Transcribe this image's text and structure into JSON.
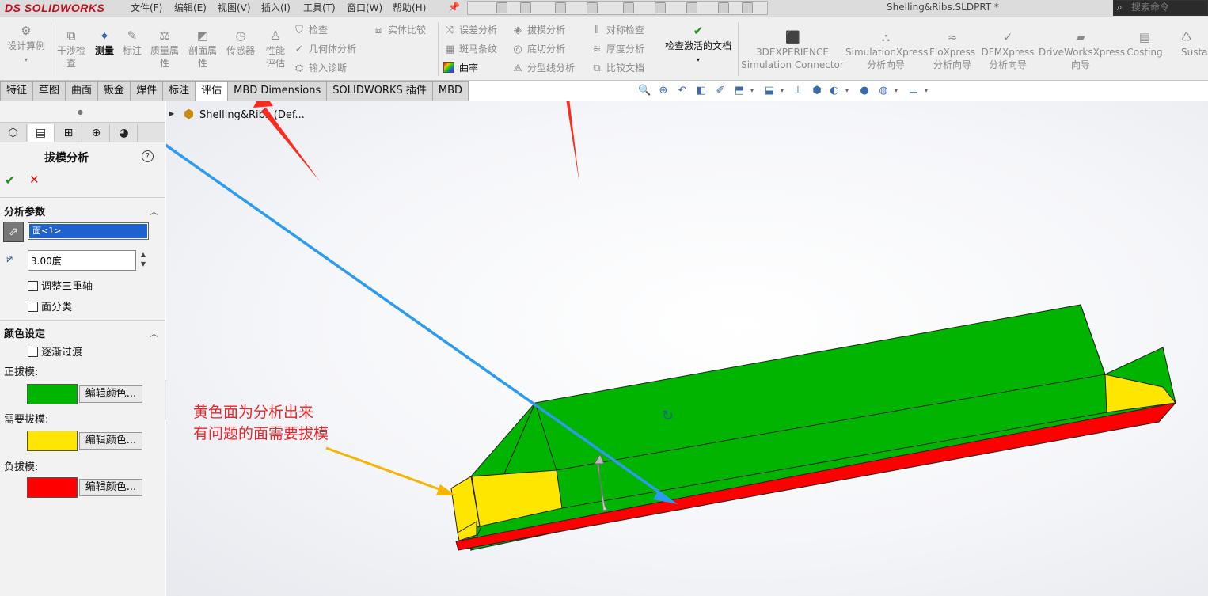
{
  "app": {
    "logo_prefix": "DS",
    "logo_text": "SOLIDWORKS",
    "document_title": "Shelling&Ribs.SLDPRT *",
    "search_placeholder": "搜索命令",
    "menu": [
      "文件(F)",
      "编辑(E)",
      "视图(V)",
      "插入(I)",
      "工具(T)",
      "窗口(W)",
      "帮助(H)"
    ]
  },
  "ribbon": {
    "design_study": "设计算例",
    "interference": [
      "干涉检",
      "查"
    ],
    "measure": "测量",
    "markup": "标注",
    "mass_props": [
      "质量属",
      "性"
    ],
    "section_props": [
      "剖面属",
      "性"
    ],
    "sensor": "传感器",
    "performance": [
      "性能",
      "评估"
    ],
    "check": "检查",
    "geometry_analysis": "几何体分析",
    "import_diagnostics": "输入诊断",
    "compare_bodies": "实体比较",
    "deviation": "误差分析",
    "zebra": "斑马条纹",
    "curvature": "曲率",
    "draft_analysis": "拔模分析",
    "undercut": "底切分析",
    "parting_line": "分型线分析",
    "symmetry": "对称检查",
    "thickness": "厚度分析",
    "compare_docs": "比较文档",
    "check_active_doc": "检查激活的文档",
    "connector": [
      "3DEXPERIENCE",
      "Simulation Connector"
    ],
    "simxpress": [
      "SimulationXpress",
      "分析向导"
    ],
    "floxpress": [
      "FloXpress",
      "分析向导"
    ],
    "dfmxpress": [
      "DFMXpress",
      "分析向导"
    ],
    "driveworks": [
      "DriveWorksXpress",
      "向导"
    ],
    "costing": "Costing",
    "sustain": "Susta"
  },
  "tabs": [
    "特征",
    "草图",
    "曲面",
    "钣金",
    "焊件",
    "标注",
    "评估",
    "MBD Dimensions",
    "SOLIDWORKS 插件",
    "MBD"
  ],
  "active_tab": "评估",
  "panel": {
    "title": "拔模分析",
    "analysis_params": "分析参数",
    "face_item": "面<1>",
    "angle_value": "3.00度",
    "adjust_triad": "调整三重轴",
    "face_classification": "面分类",
    "color_settings": "颜色设定",
    "gradual_transition": "逐渐过渡",
    "positive_draft": "正拔模:",
    "requires_draft": "需要拔模:",
    "negative_draft": "负拔模:",
    "edit_color": "编辑颜色...",
    "colors": {
      "positive": "#00b400",
      "requires": "#ffe600",
      "negative": "#ff0000"
    }
  },
  "tree": {
    "part_name": "Shelling&Ribs  (Def..."
  },
  "annotation": {
    "line1": "黄色面为分析出来",
    "line2": "有问题的面需要拔模",
    "colors": {
      "red_arrow": "#ff2a1e",
      "blue_arrow": "#2b9bf0",
      "orange_arrow": "#f5b400"
    }
  }
}
